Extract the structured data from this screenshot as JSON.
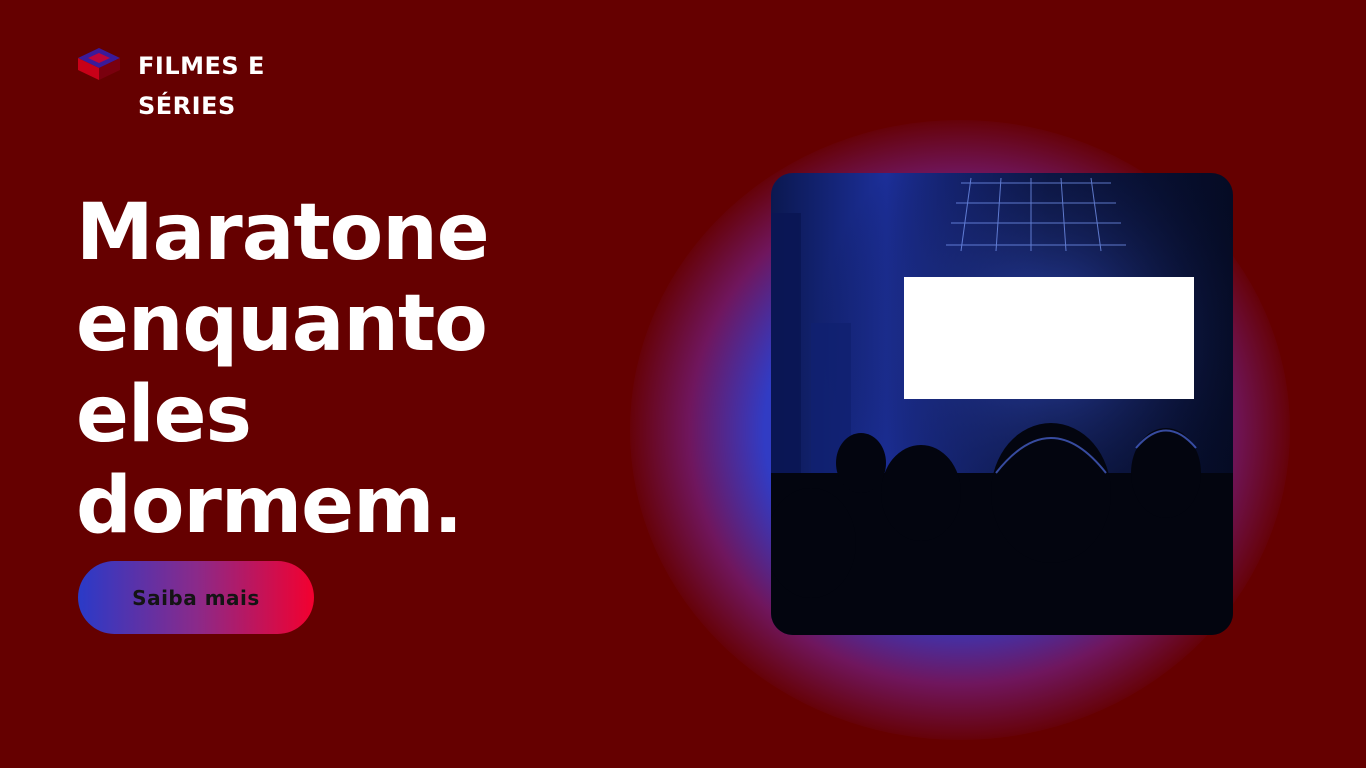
{
  "brand": {
    "name_line1": "FILMES E",
    "name_line2": "SÉRIES"
  },
  "hero": {
    "headline_lines": [
      "Maratone",
      "enquanto",
      "eles",
      "dormem."
    ],
    "cta_label": "Saiba mais"
  },
  "colors": {
    "background": "#650000",
    "text": "#ffffff",
    "cta_gradient_start": "#2a3ac8",
    "cta_gradient_end": "#f3002f",
    "glow": "#2846e6"
  },
  "image": {
    "subject": "cinema-audience-screen"
  }
}
